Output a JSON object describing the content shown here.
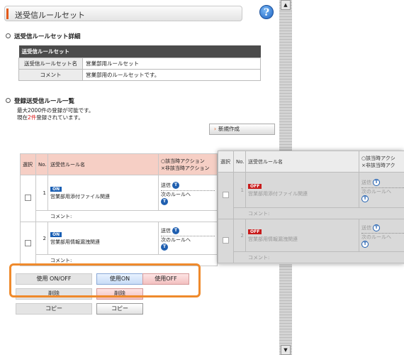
{
  "header": {
    "title": "送受信ルールセット",
    "help_icon": "?"
  },
  "details": {
    "section_title": "送受信ルールセット詳細",
    "table_title": "送受信ルールセット",
    "rows": [
      {
        "key": "送受信ルールセット名",
        "value": "営業部用ルールセット"
      },
      {
        "key": "コメント",
        "value": "営業部用のルールセットです。"
      }
    ]
  },
  "rules": {
    "section_title": "登録送受信ルール一覧",
    "info_line1": "最大2000件の登録が可能です。",
    "info_prefix": "現在",
    "info_count": "2件",
    "info_suffix": "登録されています。",
    "new_button": "新規作成",
    "columns": {
      "select": "選択",
      "no": "No.",
      "name": "送受信ルール名",
      "action_match": "○該当時アクション",
      "action_nomatch": "×非該当時アクション"
    },
    "items": [
      {
        "no": "1",
        "status": "ON",
        "name": "営業部用添付ファイル関連",
        "send": "送信",
        "next": "次のルールへ",
        "comment_label": "コメント:"
      },
      {
        "no": "2",
        "status": "ON",
        "name": "営業部用情報漏洩関連",
        "send": "送信",
        "next": "次のルールへ",
        "comment_label": "コメント:"
      }
    ]
  },
  "buttons": {
    "usage_label": "使用 ON/OFF",
    "on": "使用ON",
    "off": "使用OFF",
    "delete_label": "削除",
    "delete": "削除",
    "copy_label": "コピー",
    "copy": "コピー"
  },
  "overlay": {
    "columns": {
      "select": "選択",
      "no": "No.",
      "name": "送受信ルール名",
      "action_match": "○該当時アクシ",
      "action_nomatch": "×非該当時アク"
    },
    "items": [
      {
        "no": "1",
        "status": "OFF",
        "name": "営業部用添付ファイル関連",
        "send": "送信",
        "next": "次のルールへ",
        "comment_label": "コメント:"
      },
      {
        "no": "2",
        "status": "OFF",
        "name": "営業部用情報漏洩関連",
        "send": "送信",
        "next": "次のルールへ",
        "comment_label": "コメント:"
      }
    ]
  },
  "colors": {
    "accent": "#e35a1a",
    "highlight": "#ef8a2c",
    "on": "#1a5fb4",
    "off": "#c81c1c",
    "header_row": "#f6cfc5"
  }
}
